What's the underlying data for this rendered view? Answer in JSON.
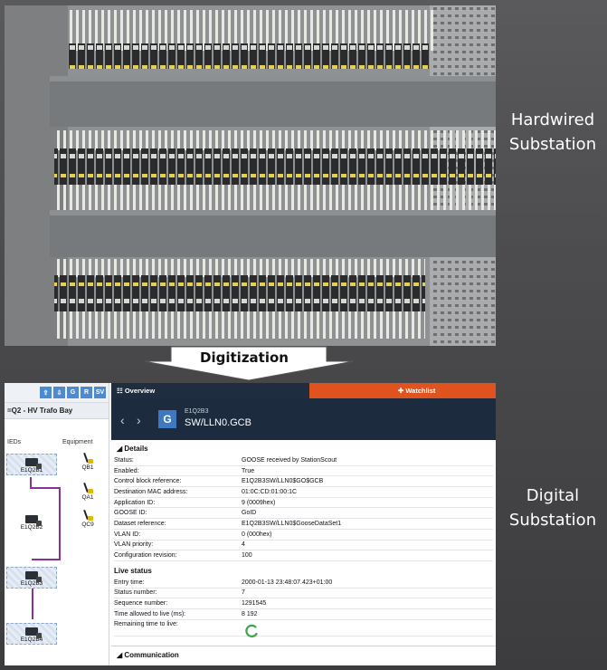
{
  "labels": {
    "hardwired": "Hardwired Substation",
    "arrow": "Digitization",
    "digital": "Digital Substation"
  },
  "left_panel": {
    "toolbar": [
      "upload-icon",
      "download-icon",
      "G",
      "R",
      "SV"
    ],
    "bay_title": "=Q2 - HV Trafo Bay",
    "col_ieds": "IEDs",
    "col_equipment": "Equipment",
    "ieds": [
      "E1Q2B1",
      "E1Q2B2",
      "E1Q2B3",
      "E1Q2B4"
    ],
    "equipment": [
      "QB1",
      "QA1",
      "QC9"
    ]
  },
  "tabs": {
    "overview": "Overview",
    "watchlist": "Watchlist"
  },
  "header": {
    "badge": "G",
    "subtitle": "E1Q2B3",
    "title": "SW/LLN0.GCB"
  },
  "details": {
    "section": "Details",
    "rows": [
      {
        "k": "Status:",
        "v": "GOOSE received by StationScout"
      },
      {
        "k": "Enabled:",
        "v": "True"
      },
      {
        "k": "Control block reference:",
        "v": "E1Q2B3SW/LLN0$GO$GCB"
      },
      {
        "k": "Destination MAC address:",
        "v": "01:0C:CD:01:00:1C"
      },
      {
        "k": "Application ID:",
        "v": "9 (0009hex)"
      },
      {
        "k": "GOOSE ID:",
        "v": "GoID"
      },
      {
        "k": "Dataset reference:",
        "v": "E1Q2B3SW/LLN0$GooseDataSet1"
      },
      {
        "k": "VLAN ID:",
        "v": "0 (000hex)"
      },
      {
        "k": "VLAN priority:",
        "v": "4"
      },
      {
        "k": "Configuration revision:",
        "v": "100"
      }
    ]
  },
  "live_status": {
    "section": "Live status",
    "rows": [
      {
        "k": "Entry time:",
        "v": "2000-01-13 23:48:07.423+01:00"
      },
      {
        "k": "Status number:",
        "v": "7"
      },
      {
        "k": "Sequence number:",
        "v": "1291545"
      },
      {
        "k": "Time allowed to live (ms):",
        "v": "8 192"
      }
    ],
    "remaining_label": "Remaining time to live:"
  },
  "communication": "Communication",
  "colors": {
    "header_bg": "#1c2b3e",
    "watchlist_bg": "#e0521e",
    "accent_blue": "#3f78c0",
    "connector": "#8b2f9c",
    "spinner": "#3aa64a"
  }
}
